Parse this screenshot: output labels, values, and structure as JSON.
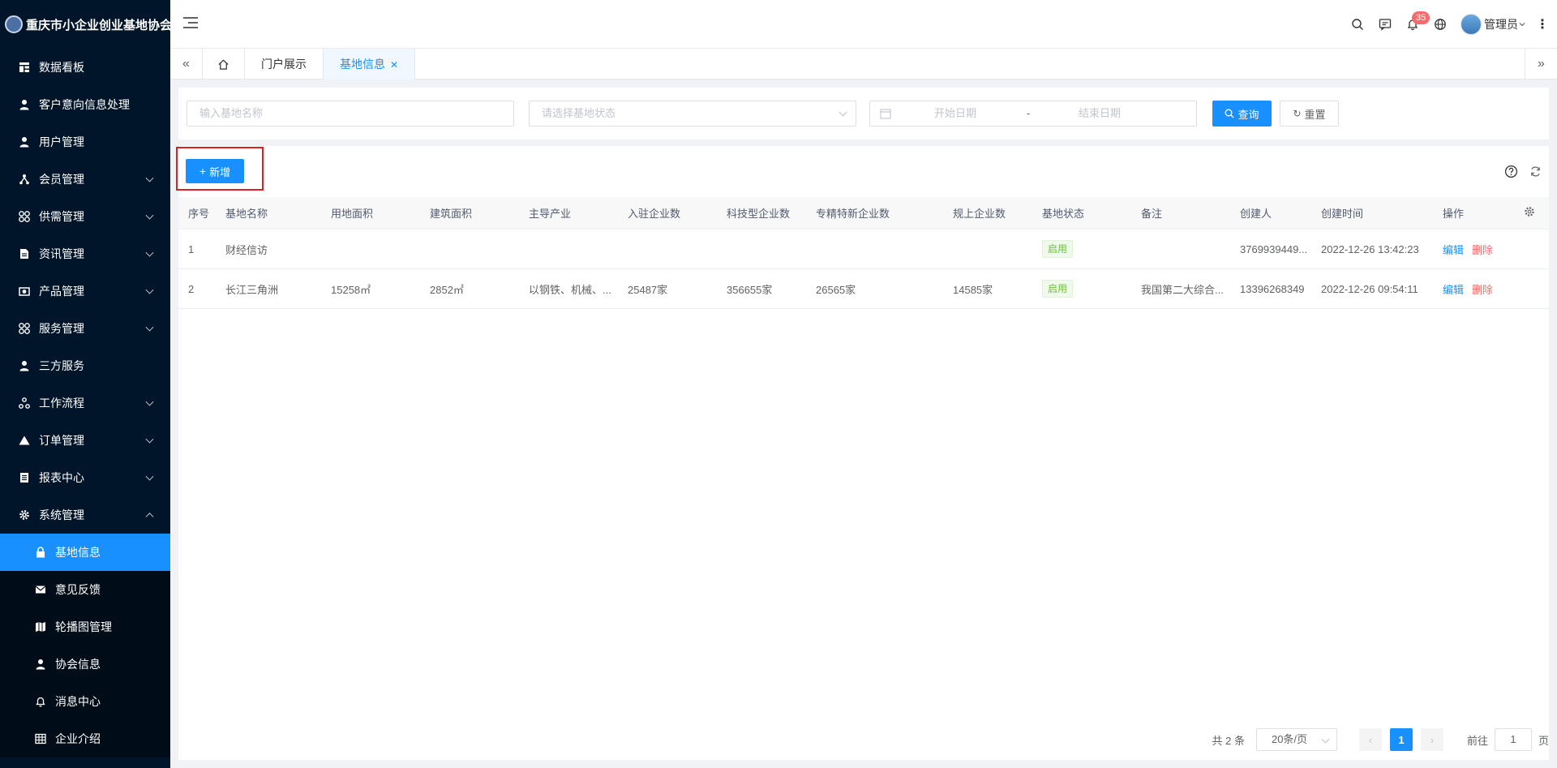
{
  "app": {
    "title": "重庆市小企业创业基地协会"
  },
  "sidebar": {
    "items": [
      {
        "label": "数据看板",
        "icon": "dashboard-icon"
      },
      {
        "label": "客户意向信息处理",
        "icon": "user-icon"
      },
      {
        "label": "用户管理",
        "icon": "user-icon"
      },
      {
        "label": "会员管理",
        "icon": "tree-icon",
        "expandable": true
      },
      {
        "label": "供需管理",
        "icon": "cluster-icon",
        "expandable": true
      },
      {
        "label": "资讯管理",
        "icon": "document-icon",
        "expandable": true
      },
      {
        "label": "产品管理",
        "icon": "camera-icon",
        "expandable": true
      },
      {
        "label": "服务管理",
        "icon": "cluster-icon",
        "expandable": true
      },
      {
        "label": "三方服务",
        "icon": "user-icon"
      },
      {
        "label": "工作流程",
        "icon": "workflow-icon",
        "expandable": true
      },
      {
        "label": "订单管理",
        "icon": "triangle-icon",
        "expandable": true
      },
      {
        "label": "报表中心",
        "icon": "report-icon",
        "expandable": true
      },
      {
        "label": "系统管理",
        "icon": "gear-icon",
        "expandable": true,
        "expanded": true
      }
    ],
    "submenu": [
      {
        "label": "基地信息",
        "icon": "lock-icon",
        "active": true
      },
      {
        "label": "意见反馈",
        "icon": "mail-icon"
      },
      {
        "label": "轮播图管理",
        "icon": "map-icon"
      },
      {
        "label": "协会信息",
        "icon": "user-icon"
      },
      {
        "label": "消息中心",
        "icon": "bell-icon"
      },
      {
        "label": "企业介绍",
        "icon": "table-icon"
      }
    ]
  },
  "header": {
    "notification_count": "35",
    "user_name": "管理员"
  },
  "tabs": [
    {
      "label": "门户展示"
    },
    {
      "label": "基地信息",
      "active": true
    }
  ],
  "search": {
    "name_placeholder": "输入基地名称",
    "status_placeholder": "请选择基地状态",
    "start_placeholder": "开始日期",
    "range_separator": "-",
    "end_placeholder": "结束日期",
    "query_label": "查询",
    "reset_label": "重置"
  },
  "toolbar": {
    "add_label": "新增"
  },
  "table": {
    "columns": [
      "序号",
      "基地名称",
      "用地面积",
      "建筑面积",
      "主导产业",
      "入驻企业数",
      "科技型企业数",
      "专精特新企业数",
      "规上企业数",
      "基地状态",
      "备注",
      "创建人",
      "创建时间",
      "操作"
    ],
    "rows": [
      {
        "index": "1",
        "name": "财经信访",
        "land_area": "",
        "building_area": "",
        "industry": "",
        "companies": "",
        "tech_companies": "",
        "specialized_companies": "",
        "scale_companies": "",
        "status": "启用",
        "remark": "",
        "creator": "3769939449...",
        "created_at": "2022-12-26 13:42:23",
        "edit": "编辑",
        "delete": "删除"
      },
      {
        "index": "2",
        "name": "长江三角洲",
        "land_area": "15258㎡",
        "building_area": "2852㎡",
        "industry": "以钢铁、机械、...",
        "companies": "25487家",
        "tech_companies": "356655家",
        "specialized_companies": "26565家",
        "scale_companies": "14585家",
        "status": "启用",
        "remark": "我国第二大综合...",
        "creator": "13396268349",
        "created_at": "2022-12-26 09:54:11",
        "edit": "编辑",
        "delete": "删除"
      }
    ]
  },
  "pagination": {
    "total": "共 2 条",
    "page_size": "20条/页",
    "current_page": "1",
    "goto_label": "前往",
    "goto_value": "1",
    "page_unit": "页"
  },
  "colors": {
    "primary": "#1890ff",
    "sidebar_bg": "#001529",
    "danger": "#f56c6c",
    "success": "#67c23a",
    "highlight_box": "#e02020"
  }
}
